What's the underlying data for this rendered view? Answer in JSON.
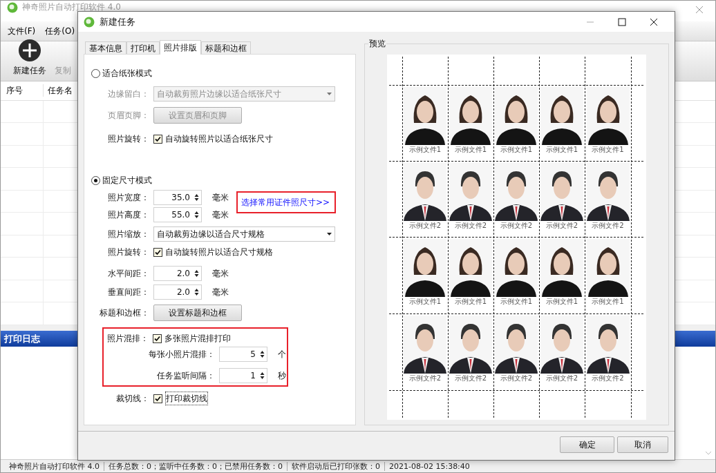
{
  "main_window": {
    "title": "神奇照片自动打印软件 4.0",
    "menu": [
      "文件(F)",
      "任务(O)"
    ],
    "toolbar": [
      {
        "label": "新建任务",
        "disabled": false
      },
      {
        "label": "复制",
        "disabled": true
      }
    ],
    "table": {
      "columns": [
        "序号",
        "任务名"
      ]
    },
    "log_panel": {
      "title": "打印日志"
    },
    "status_bar": [
      "神奇照片自动打印软件 4.0",
      "任务总数：0；监听中任务数：0；已禁用任务数：0",
      "软件启动后已打印张数：0",
      "2021-08-02 15:38:40"
    ]
  },
  "dialog": {
    "title": "新建任务",
    "tabs": [
      {
        "label": "基本信息",
        "selected": false
      },
      {
        "label": "打印机",
        "selected": false
      },
      {
        "label": "照片排版",
        "selected": true
      },
      {
        "label": "标题和边框",
        "selected": false
      }
    ],
    "fit_paper_mode": {
      "label": "适合纸张模式",
      "selected": false,
      "margin": {
        "label": "边缘留白：",
        "value": "自动裁剪照片边缘以适合纸张尺寸",
        "disabled": true
      },
      "header_footer": {
        "label": "页眉页脚：",
        "button": "设置页眉和页脚",
        "disabled": true
      },
      "rotate": {
        "label": "照片旋转：",
        "checkbox": "自动旋转照片以适合纸张尺寸",
        "checked": true
      }
    },
    "fixed_size_mode": {
      "label": "固定尺寸模式",
      "selected": true,
      "width": {
        "label": "照片宽度：",
        "value": "35.0",
        "unit": "毫米"
      },
      "height": {
        "label": "照片高度：",
        "value": "55.0",
        "unit": "毫米"
      },
      "size_link": "选择常用证件照尺寸>>",
      "scale": {
        "label": "照片缩放：",
        "value": "自动裁剪边缘以适合尺寸规格"
      },
      "rotate": {
        "label": "照片旋转：",
        "checkbox": "自动旋转照片以适合尺寸规格",
        "checked": true
      },
      "h_spacing": {
        "label": "水平间距：",
        "value": "2.0",
        "unit": "毫米"
      },
      "v_spacing": {
        "label": "垂直间距：",
        "value": "2.0",
        "unit": "毫米"
      },
      "title_border": {
        "label": "标题和边框：",
        "button": "设置标题和边框"
      },
      "mix": {
        "label": "照片混排：",
        "checkbox": "多张照片混排打印",
        "checked": true,
        "per_sheet": {
          "label": "每张小照片混排：",
          "value": "5",
          "unit": "个"
        },
        "interval": {
          "label": "任务监听间隔：",
          "value": "1",
          "unit": "秒"
        }
      },
      "cut_line": {
        "label": "裁切线：",
        "checkbox": "打印裁切线",
        "checked": true
      }
    },
    "preview": {
      "title": "预览",
      "rows": [
        {
          "kind": "female",
          "captions": [
            "示例文件1",
            "示例文件1",
            "示例文件1",
            "示例文件1",
            "示例文件1"
          ]
        },
        {
          "kind": "male",
          "captions": [
            "示例文件2",
            "示例文件2",
            "示例文件2",
            "示例文件2",
            "示例文件2"
          ]
        },
        {
          "kind": "female",
          "captions": [
            "示例文件1",
            "示例文件1",
            "示例文件1",
            "示例文件1",
            "示例文件1"
          ]
        },
        {
          "kind": "male",
          "captions": [
            "示例文件2",
            "示例文件2",
            "示例文件2",
            "示例文件2",
            "示例文件2"
          ]
        }
      ]
    },
    "buttons": [
      "确定",
      "取消"
    ]
  }
}
